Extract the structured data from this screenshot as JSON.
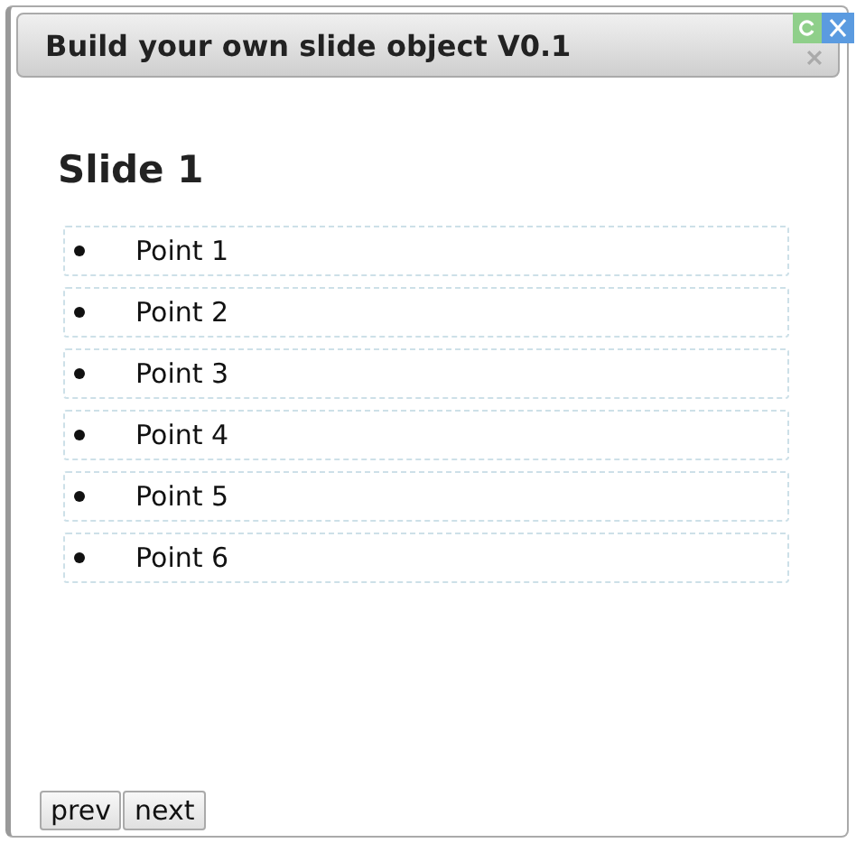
{
  "window": {
    "title": "Build your own slide object V0.1"
  },
  "slide": {
    "title": "Slide 1",
    "points": [
      {
        "text": "Point 1"
      },
      {
        "text": "Point 2"
      },
      {
        "text": "Point 3"
      },
      {
        "text": "Point 4"
      },
      {
        "text": "Point 5"
      },
      {
        "text": "Point 6"
      }
    ]
  },
  "buttons": [
    {
      "label": "prev"
    },
    {
      "label": "next"
    }
  ]
}
